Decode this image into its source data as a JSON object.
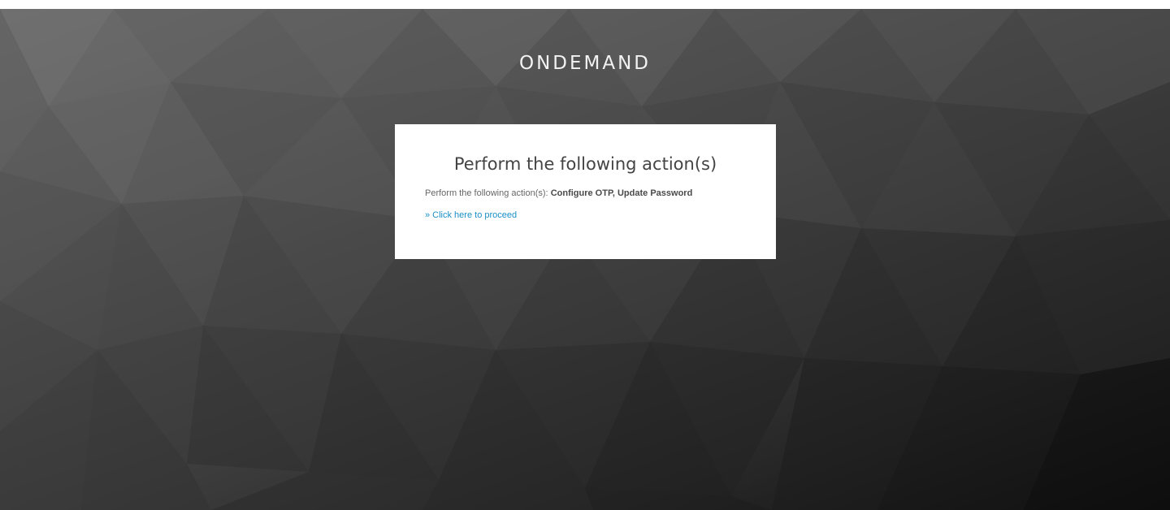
{
  "brand": {
    "name": "ONDEMAND"
  },
  "card": {
    "title": "Perform the following action(s)",
    "message_prefix": "Perform the following action(s):",
    "message_actions": "Configure OTP, Update Password",
    "proceed_link": "» Click here to proceed"
  },
  "colors": {
    "background_light": "#6b6b6b",
    "background_dark": "#0d0d0d",
    "card_background": "#ffffff",
    "link": "#1a8fc7",
    "brand_text": "#f2f2f2"
  }
}
